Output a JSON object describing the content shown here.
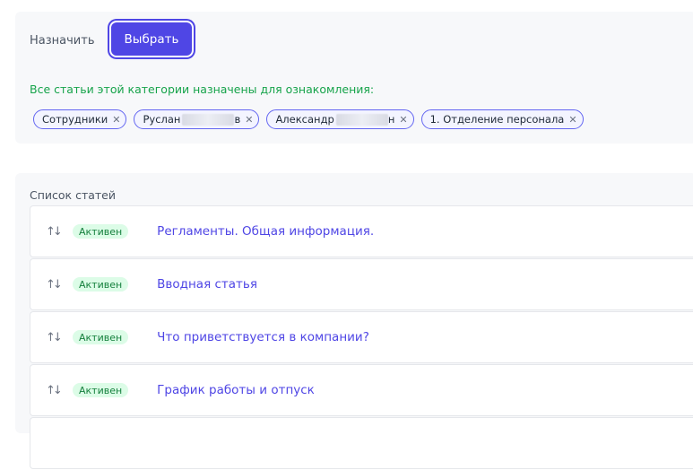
{
  "assign": {
    "label": "Назначить",
    "choose_button": "Выбрать"
  },
  "assigned_info": "Все статьи этой категории назначены для ознакомления:",
  "chips": [
    {
      "pre": "Сотрудники",
      "post": ""
    },
    {
      "pre": "Руслан",
      "post": "в"
    },
    {
      "pre": "Александр",
      "post": "н"
    },
    {
      "pre": "1. Отделение персонала",
      "post": ""
    }
  ],
  "list": {
    "title": "Список статей",
    "status_label": "Активен",
    "items": [
      {
        "title": "Регламенты. Общая информация."
      },
      {
        "title": "Вводная статья"
      },
      {
        "title": "Что приветствуется в компании?"
      },
      {
        "title": "График работы и отпуск"
      }
    ]
  },
  "colors": {
    "accent": "#4f46e5",
    "success_text": "#16a34a",
    "badge_bg": "#dcfce7",
    "panel_bg": "#f7f8fa"
  },
  "icons": {
    "remove": "close-icon",
    "sort": "sort-arrows-icon"
  }
}
